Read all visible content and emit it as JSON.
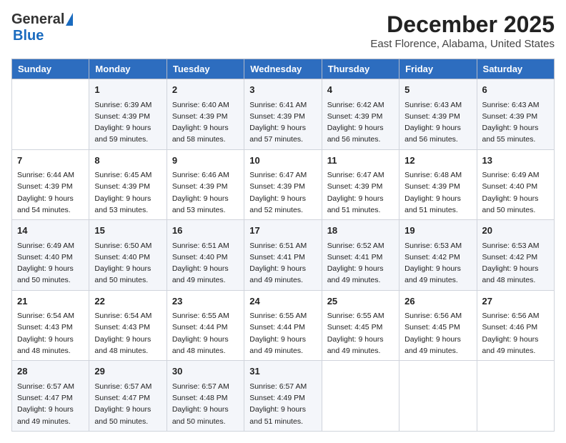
{
  "logo": {
    "general": "General",
    "blue": "Blue"
  },
  "title": "December 2025",
  "subtitle": "East Florence, Alabama, United States",
  "weekdays": [
    "Sunday",
    "Monday",
    "Tuesday",
    "Wednesday",
    "Thursday",
    "Friday",
    "Saturday"
  ],
  "weeks": [
    [
      {
        "day": "",
        "info": ""
      },
      {
        "day": "1",
        "info": "Sunrise: 6:39 AM\nSunset: 4:39 PM\nDaylight: 9 hours\nand 59 minutes."
      },
      {
        "day": "2",
        "info": "Sunrise: 6:40 AM\nSunset: 4:39 PM\nDaylight: 9 hours\nand 58 minutes."
      },
      {
        "day": "3",
        "info": "Sunrise: 6:41 AM\nSunset: 4:39 PM\nDaylight: 9 hours\nand 57 minutes."
      },
      {
        "day": "4",
        "info": "Sunrise: 6:42 AM\nSunset: 4:39 PM\nDaylight: 9 hours\nand 56 minutes."
      },
      {
        "day": "5",
        "info": "Sunrise: 6:43 AM\nSunset: 4:39 PM\nDaylight: 9 hours\nand 56 minutes."
      },
      {
        "day": "6",
        "info": "Sunrise: 6:43 AM\nSunset: 4:39 PM\nDaylight: 9 hours\nand 55 minutes."
      }
    ],
    [
      {
        "day": "7",
        "info": "Sunrise: 6:44 AM\nSunset: 4:39 PM\nDaylight: 9 hours\nand 54 minutes."
      },
      {
        "day": "8",
        "info": "Sunrise: 6:45 AM\nSunset: 4:39 PM\nDaylight: 9 hours\nand 53 minutes."
      },
      {
        "day": "9",
        "info": "Sunrise: 6:46 AM\nSunset: 4:39 PM\nDaylight: 9 hours\nand 53 minutes."
      },
      {
        "day": "10",
        "info": "Sunrise: 6:47 AM\nSunset: 4:39 PM\nDaylight: 9 hours\nand 52 minutes."
      },
      {
        "day": "11",
        "info": "Sunrise: 6:47 AM\nSunset: 4:39 PM\nDaylight: 9 hours\nand 51 minutes."
      },
      {
        "day": "12",
        "info": "Sunrise: 6:48 AM\nSunset: 4:39 PM\nDaylight: 9 hours\nand 51 minutes."
      },
      {
        "day": "13",
        "info": "Sunrise: 6:49 AM\nSunset: 4:40 PM\nDaylight: 9 hours\nand 50 minutes."
      }
    ],
    [
      {
        "day": "14",
        "info": "Sunrise: 6:49 AM\nSunset: 4:40 PM\nDaylight: 9 hours\nand 50 minutes."
      },
      {
        "day": "15",
        "info": "Sunrise: 6:50 AM\nSunset: 4:40 PM\nDaylight: 9 hours\nand 50 minutes."
      },
      {
        "day": "16",
        "info": "Sunrise: 6:51 AM\nSunset: 4:40 PM\nDaylight: 9 hours\nand 49 minutes."
      },
      {
        "day": "17",
        "info": "Sunrise: 6:51 AM\nSunset: 4:41 PM\nDaylight: 9 hours\nand 49 minutes."
      },
      {
        "day": "18",
        "info": "Sunrise: 6:52 AM\nSunset: 4:41 PM\nDaylight: 9 hours\nand 49 minutes."
      },
      {
        "day": "19",
        "info": "Sunrise: 6:53 AM\nSunset: 4:42 PM\nDaylight: 9 hours\nand 49 minutes."
      },
      {
        "day": "20",
        "info": "Sunrise: 6:53 AM\nSunset: 4:42 PM\nDaylight: 9 hours\nand 48 minutes."
      }
    ],
    [
      {
        "day": "21",
        "info": "Sunrise: 6:54 AM\nSunset: 4:43 PM\nDaylight: 9 hours\nand 48 minutes."
      },
      {
        "day": "22",
        "info": "Sunrise: 6:54 AM\nSunset: 4:43 PM\nDaylight: 9 hours\nand 48 minutes."
      },
      {
        "day": "23",
        "info": "Sunrise: 6:55 AM\nSunset: 4:44 PM\nDaylight: 9 hours\nand 48 minutes."
      },
      {
        "day": "24",
        "info": "Sunrise: 6:55 AM\nSunset: 4:44 PM\nDaylight: 9 hours\nand 49 minutes."
      },
      {
        "day": "25",
        "info": "Sunrise: 6:55 AM\nSunset: 4:45 PM\nDaylight: 9 hours\nand 49 minutes."
      },
      {
        "day": "26",
        "info": "Sunrise: 6:56 AM\nSunset: 4:45 PM\nDaylight: 9 hours\nand 49 minutes."
      },
      {
        "day": "27",
        "info": "Sunrise: 6:56 AM\nSunset: 4:46 PM\nDaylight: 9 hours\nand 49 minutes."
      }
    ],
    [
      {
        "day": "28",
        "info": "Sunrise: 6:57 AM\nSunset: 4:47 PM\nDaylight: 9 hours\nand 49 minutes."
      },
      {
        "day": "29",
        "info": "Sunrise: 6:57 AM\nSunset: 4:47 PM\nDaylight: 9 hours\nand 50 minutes."
      },
      {
        "day": "30",
        "info": "Sunrise: 6:57 AM\nSunset: 4:48 PM\nDaylight: 9 hours\nand 50 minutes."
      },
      {
        "day": "31",
        "info": "Sunrise: 6:57 AM\nSunset: 4:49 PM\nDaylight: 9 hours\nand 51 minutes."
      },
      {
        "day": "",
        "info": ""
      },
      {
        "day": "",
        "info": ""
      },
      {
        "day": "",
        "info": ""
      }
    ]
  ]
}
